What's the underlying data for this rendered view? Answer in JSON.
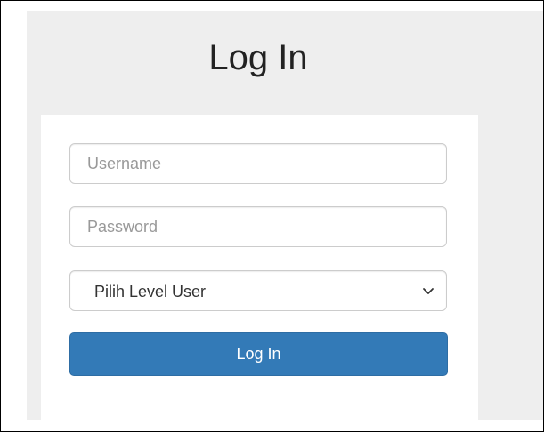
{
  "login": {
    "title": "Log In",
    "username_placeholder": "Username",
    "password_placeholder": "Password",
    "level_select": {
      "selected": "Pilih Level User"
    },
    "submit_label": "Log In"
  },
  "colors": {
    "primary_button": "#337ab7",
    "panel_background": "#eeeeee"
  },
  "icons": {
    "select_arrow": "chevron-down-icon"
  }
}
